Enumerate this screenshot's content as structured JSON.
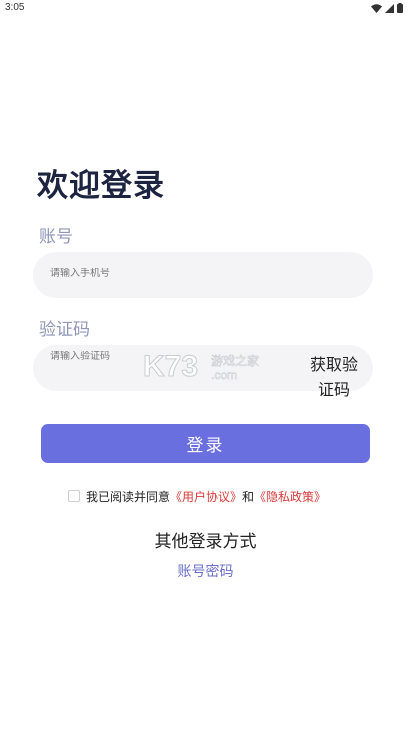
{
  "status_bar": {
    "time": "3:05",
    "icons": [
      "wifi-icon",
      "signal-icon",
      "battery-icon"
    ]
  },
  "title": "欢迎登录",
  "account": {
    "label": "账号",
    "placeholder": "请输入手机号"
  },
  "code": {
    "label": "验证码",
    "placeholder": "请输入验证码",
    "get_code_label": "获取验证码"
  },
  "watermark": {
    "brand": "K73",
    "text_top": "游戏之家",
    "text_bottom": ".com"
  },
  "login_button": "登录",
  "agreement": {
    "prefix": "我已阅读并同意",
    "user_agreement": "《用户协议》",
    "conjunction": "和",
    "privacy_policy": "《隐私政策》"
  },
  "other_login": {
    "title": "其他登录方式",
    "password_login": "账号密码"
  },
  "colors": {
    "primary": "#6a6fe0",
    "title": "#1d2441",
    "label": "#8e96b8",
    "link_red": "#d93a3a",
    "input_bg": "#f4f4f6"
  }
}
